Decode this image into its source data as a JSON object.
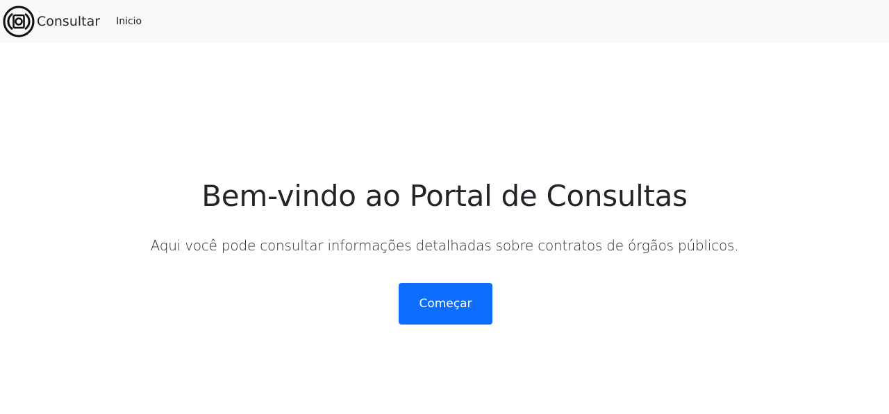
{
  "navbar": {
    "brand_label": "Consultar",
    "brand_icon": "circle-target-icon",
    "links": [
      {
        "label": "Inicio"
      }
    ],
    "background": "#f8f9fa"
  },
  "hero": {
    "title": "Bem-vindo ao Portal de Consultas",
    "description": "Aqui você pode consultar informações detalhadas sobre contratos de órgãos públicos.",
    "cta_label": "Começar",
    "cta_color": "#0d6efd"
  }
}
